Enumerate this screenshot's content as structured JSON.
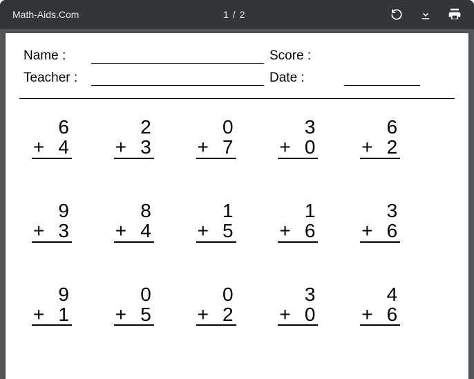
{
  "toolbar": {
    "title": "Math-Aids.Com",
    "page_indicator": "1 / 2"
  },
  "header": {
    "name_label": "Name :",
    "teacher_label": "Teacher :",
    "score_label": "Score :",
    "date_label": "Date :"
  },
  "problems": [
    {
      "a": "6",
      "op": "+",
      "b": "4"
    },
    {
      "a": "2",
      "op": "+",
      "b": "3"
    },
    {
      "a": "0",
      "op": "+",
      "b": "7"
    },
    {
      "a": "3",
      "op": "+",
      "b": "0"
    },
    {
      "a": "6",
      "op": "+",
      "b": "2"
    },
    {
      "a": "9",
      "op": "+",
      "b": "3"
    },
    {
      "a": "8",
      "op": "+",
      "b": "4"
    },
    {
      "a": "1",
      "op": "+",
      "b": "5"
    },
    {
      "a": "1",
      "op": "+",
      "b": "6"
    },
    {
      "a": "3",
      "op": "+",
      "b": "6"
    },
    {
      "a": "9",
      "op": "+",
      "b": "1"
    },
    {
      "a": "0",
      "op": "+",
      "b": "5"
    },
    {
      "a": "0",
      "op": "+",
      "b": "2"
    },
    {
      "a": "3",
      "op": "+",
      "b": "0"
    },
    {
      "a": "4",
      "op": "+",
      "b": "6"
    }
  ]
}
